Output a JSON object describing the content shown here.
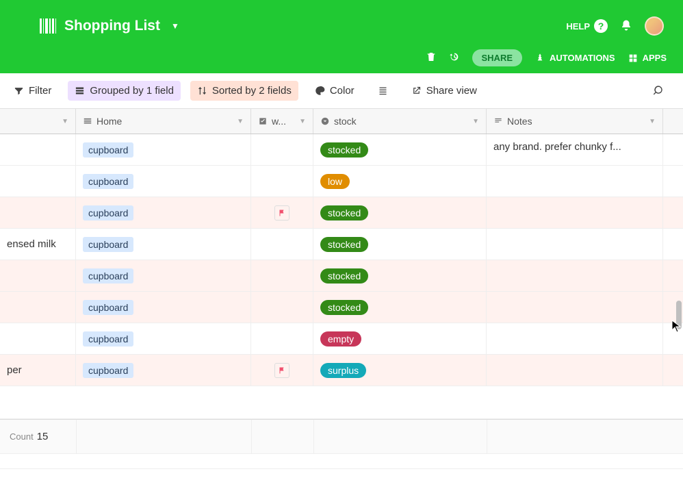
{
  "header": {
    "title": "Shopping List",
    "help_label": "HELP",
    "share_label": "SHARE",
    "automations_label": "AUTOMATIONS",
    "apps_label": "APPS"
  },
  "toolbar": {
    "filter": "Filter",
    "grouped": "Grouped by 1 field",
    "sorted": "Sorted by 2 fields",
    "color": "Color",
    "shareview": "Share view"
  },
  "columns": {
    "c1": "Home",
    "c2": "w...",
    "c3": "stock",
    "c4": "Notes"
  },
  "rows": [
    {
      "item": "",
      "loc": "cupboard",
      "flag": false,
      "stock": "stocked",
      "notes": "any brand. prefer chunky f...",
      "pink": false
    },
    {
      "item": "",
      "loc": "cupboard",
      "flag": false,
      "stock": "low",
      "notes": "",
      "pink": false
    },
    {
      "item": "",
      "loc": "cupboard",
      "flag": true,
      "stock": "stocked",
      "notes": "",
      "pink": true
    },
    {
      "item": "ensed milk",
      "loc": "cupboard",
      "flag": false,
      "stock": "stocked",
      "notes": "",
      "pink": false
    },
    {
      "item": "",
      "loc": "cupboard",
      "flag": false,
      "stock": "stocked",
      "notes": "",
      "pink": true
    },
    {
      "item": "",
      "loc": "cupboard",
      "flag": false,
      "stock": "stocked",
      "notes": "",
      "pink": true
    },
    {
      "item": "",
      "loc": "cupboard",
      "flag": false,
      "stock": "empty",
      "notes": "",
      "pink": false
    },
    {
      "item": "per",
      "loc": "cupboard",
      "flag": true,
      "stock": "surplus",
      "notes": "",
      "pink": true
    }
  ],
  "summary": {
    "count_label": "Count",
    "count_value": "15"
  }
}
